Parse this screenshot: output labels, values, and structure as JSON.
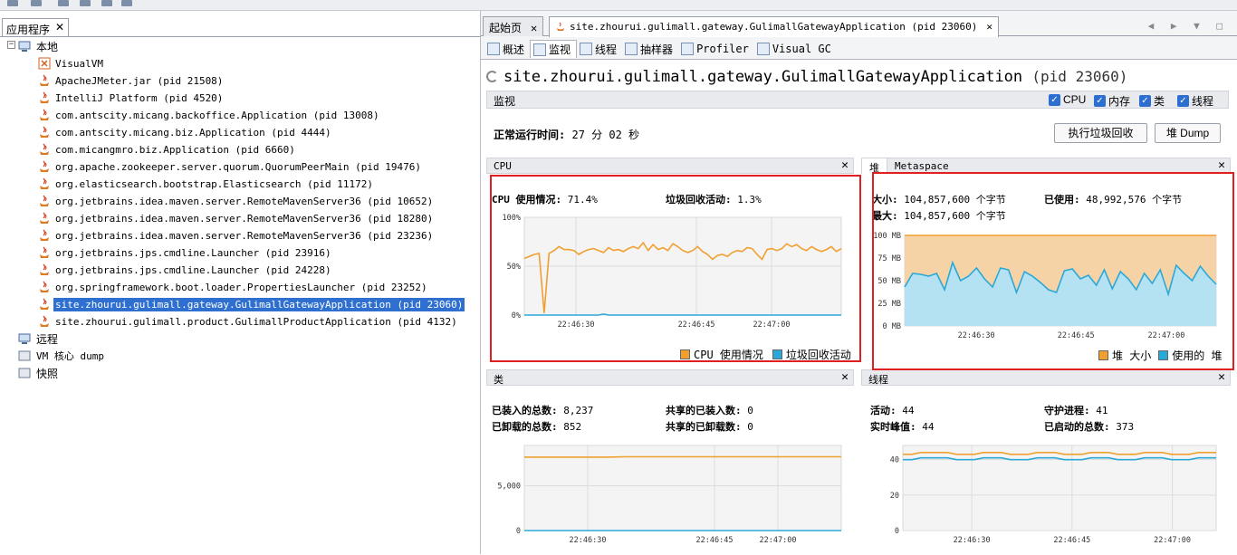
{
  "left": {
    "tab_label": "应用程序",
    "tab_close": "✕",
    "tree": {
      "local": "本地",
      "local_items": [
        "VisualVM",
        "ApacheJMeter.jar (pid 21508)",
        "IntelliJ Platform (pid 4520)",
        "com.antscity.micang.backoffice.Application (pid 13008)",
        "com.antscity.micang.biz.Application (pid 4444)",
        "com.micangmro.biz.Application (pid 6660)",
        "org.apache.zookeeper.server.quorum.QuorumPeerMain (pid 19476)",
        "org.elasticsearch.bootstrap.Elasticsearch (pid 11172)",
        "org.jetbrains.idea.maven.server.RemoteMavenServer36 (pid 10652)",
        "org.jetbrains.idea.maven.server.RemoteMavenServer36 (pid 18280)",
        "org.jetbrains.idea.maven.server.RemoteMavenServer36 (pid 23236)",
        "org.jetbrains.jps.cmdline.Launcher (pid 23916)",
        "org.jetbrains.jps.cmdline.Launcher (pid 24228)",
        "org.springframework.boot.loader.PropertiesLauncher (pid 23252)",
        "site.zhourui.gulimall.gateway.GulimallGatewayApplication (pid 23060)",
        "site.zhourui.gulimall.product.GulimallProductApplication (pid 4132)"
      ],
      "selected_index": 14,
      "remote": "远程",
      "core_dump": "VM 核心 dump",
      "snapshot": "快照"
    }
  },
  "tabs": {
    "start": "起始页",
    "active": "site.zhourui.gulimall.gateway.GulimallGatewayApplication (pid 23060)",
    "close": "✕",
    "nav": "◀ ▶ ▼ □"
  },
  "subtabs": [
    "概述",
    "监视",
    "线程",
    "抽样器",
    "Profiler",
    "Visual GC"
  ],
  "main": {
    "title": "site.zhourui.gulimall.gateway.GulimallGatewayApplication",
    "pid": "(pid 23060)",
    "monitor_label": "监视",
    "checkboxes": [
      "CPU",
      "内存",
      "类",
      "线程"
    ],
    "uptime_label": "正常运行时间:",
    "uptime_value": "27 分 02 秒",
    "gc_button": "执行垃圾回收",
    "heap_dump_button": "堆 Dump"
  },
  "cpu_panel": {
    "title": "CPU",
    "usage_label": "CPU 使用情况:",
    "usage_value": "71.4%",
    "gc_label": "垃圾回收活动:",
    "gc_value": "1.3%",
    "legend": [
      "CPU 使用情况",
      "垃圾回收活动"
    ]
  },
  "heap_panel": {
    "tab_heap": "堆",
    "tab_meta": "Metaspace",
    "size_label": "大小:",
    "size_value": "104,857,600 个字节",
    "used_label": "已使用:",
    "used_value": "48,992,576 个字节",
    "max_label": "最大:",
    "max_value": "104,857,600 个字节",
    "legend": [
      "堆 大小",
      "使用的 堆"
    ]
  },
  "classes_panel": {
    "title": "类",
    "loaded_label": "已装入的总数:",
    "loaded_value": "8,237",
    "unloaded_label": "已卸载的总数:",
    "unloaded_value": "852",
    "shared_loaded_label": "共享的已装入数:",
    "shared_loaded_value": "0",
    "shared_unloaded_label": "共享的已卸载数:",
    "shared_unloaded_value": "0"
  },
  "threads_panel": {
    "title": "线程",
    "live_label": "活动:",
    "live_value": "44",
    "peak_label": "实时峰值:",
    "peak_value": "44",
    "daemon_label": "守护进程:",
    "daemon_value": "41",
    "started_label": "已启动的总数:",
    "started_value": "373"
  },
  "colors": {
    "orange": "#f0a030",
    "blue": "#2aa8d8",
    "selection": "#2f6fcf",
    "highlight_box": "#e02020"
  },
  "chart_data": [
    {
      "type": "line",
      "title": "CPU",
      "x_ticks": [
        "22:46:30",
        "22:46:45",
        "22:47:00"
      ],
      "y_ticks": [
        "100%",
        "50%",
        "0%"
      ],
      "ylim": [
        0,
        100
      ],
      "series": [
        {
          "name": "CPU 使用情况",
          "values": [
            58,
            60,
            62,
            63,
            2,
            63,
            66,
            70,
            67,
            67,
            66,
            62,
            65,
            67,
            68,
            66,
            64,
            69,
            66,
            67,
            65,
            68,
            70,
            68,
            74,
            66,
            72,
            67,
            69,
            66,
            73,
            70,
            66,
            64,
            66,
            70,
            65,
            62,
            57,
            61,
            62,
            60,
            64,
            66,
            65,
            69,
            68,
            62,
            57,
            67,
            68,
            66,
            68,
            73,
            70,
            72,
            68,
            66,
            70,
            67,
            65,
            67,
            70,
            65,
            68
          ]
        },
        {
          "name": "垃圾回收活动",
          "values": [
            0,
            0,
            0,
            0,
            0,
            0,
            0,
            0,
            0,
            0,
            0,
            0,
            0,
            0,
            0,
            0,
            1,
            0,
            0,
            0,
            0,
            0,
            0,
            0,
            0,
            0,
            0,
            0,
            0,
            0,
            0,
            0,
            0,
            0,
            0,
            0,
            0,
            0,
            0,
            0,
            0,
            0,
            0,
            0,
            0,
            0,
            0,
            0,
            0,
            0,
            0,
            0,
            0,
            0,
            0,
            0,
            0,
            0,
            0,
            0,
            0,
            0,
            0,
            0,
            0
          ]
        }
      ]
    },
    {
      "type": "area",
      "title": "堆",
      "x_ticks": [
        "22:46:30",
        "22:46:45",
        "22:47:00"
      ],
      "y_ticks": [
        "100 MB",
        "75 MB",
        "50 MB",
        "25 MB",
        "0 MB"
      ],
      "ylim": [
        0,
        100
      ],
      "series": [
        {
          "name": "堆 大小",
          "values": [
            100,
            100,
            100,
            100,
            100,
            100,
            100,
            100,
            100,
            100,
            100,
            100,
            100,
            100,
            100,
            100,
            100,
            100,
            100,
            100,
            100,
            100,
            100,
            100,
            100,
            100,
            100,
            100,
            100,
            100,
            100,
            100,
            100,
            100,
            100,
            100,
            100,
            100,
            100,
            100
          ]
        },
        {
          "name": "使用的 堆",
          "values": [
            43,
            58,
            57,
            55,
            58,
            40,
            70,
            50,
            55,
            64,
            52,
            43,
            64,
            62,
            37,
            60,
            55,
            48,
            40,
            37,
            61,
            63,
            52,
            56,
            45,
            62,
            41,
            60,
            52,
            40,
            58,
            47,
            62,
            35,
            67,
            58,
            50,
            66,
            55,
            46
          ]
        }
      ]
    },
    {
      "type": "line",
      "title": "类",
      "x_ticks": [
        "22:46:30",
        "22:46:45",
        "22:47:00"
      ],
      "y_ticks": [
        "5,000",
        "0"
      ],
      "ylim": [
        0,
        9500
      ],
      "series": [
        {
          "name": "已装入的总数",
          "values": [
            8200,
            8200,
            8200,
            8200,
            8200,
            8200,
            8237,
            8237,
            8237,
            8237,
            8237,
            8237,
            8237,
            8237,
            8237,
            8237,
            8237,
            8237,
            8237,
            8237
          ]
        },
        {
          "name": "共享的已装入数",
          "values": [
            0,
            0,
            0,
            0,
            0,
            0,
            0,
            0,
            0,
            0,
            0,
            0,
            0,
            0,
            0,
            0,
            0,
            0,
            0,
            0
          ]
        }
      ]
    },
    {
      "type": "line",
      "title": "线程",
      "x_ticks": [
        "22:46:30",
        "22:46:45",
        "22:47:00"
      ],
      "y_ticks": [
        "40",
        "20",
        "0"
      ],
      "ylim": [
        0,
        48
      ],
      "series": [
        {
          "name": "活动",
          "values": [
            43,
            43,
            44,
            44,
            44,
            44,
            43,
            43,
            43,
            44,
            44,
            44,
            43,
            43,
            43,
            44,
            44,
            44,
            43,
            43,
            43,
            44,
            44,
            44,
            43,
            43,
            43,
            44,
            44,
            44,
            43,
            43,
            43,
            44,
            44,
            44
          ]
        },
        {
          "name": "守护进程",
          "values": [
            40,
            40,
            41,
            41,
            41,
            41,
            40,
            40,
            40,
            41,
            41,
            41,
            40,
            40,
            40,
            41,
            41,
            41,
            40,
            40,
            40,
            41,
            41,
            41,
            40,
            40,
            40,
            41,
            41,
            41,
            40,
            40,
            40,
            41,
            41,
            41
          ]
        }
      ]
    }
  ]
}
